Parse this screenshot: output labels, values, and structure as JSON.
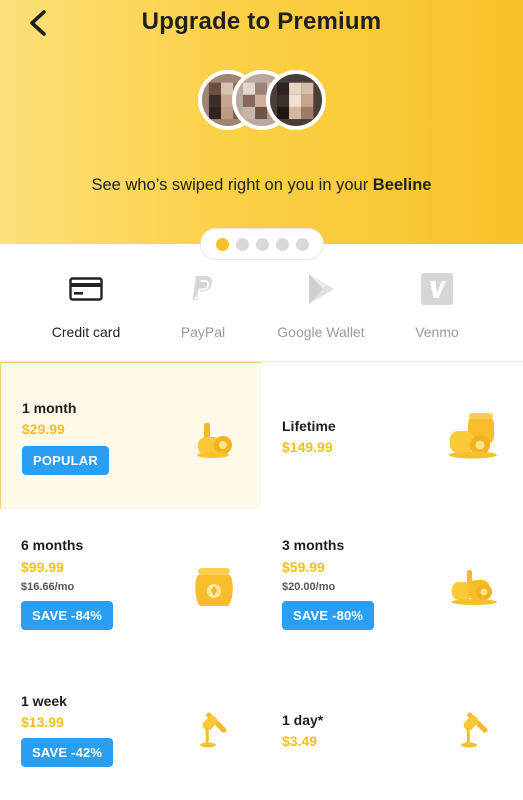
{
  "header": {
    "title": "Upgrade to Premium",
    "subtitle_prefix": "See who’s swiped right on you in your ",
    "subtitle_bold": "Beeline",
    "page_dots": 5,
    "active_dot": 0
  },
  "payment_methods": [
    {
      "label": "Credit card",
      "icon": "credit-card-icon",
      "active": true
    },
    {
      "label": "PayPal",
      "icon": "paypal-icon",
      "active": false
    },
    {
      "label": "Google Wallet",
      "icon": "google-wallet-icon",
      "active": false
    },
    {
      "label": "Venmo",
      "icon": "venmo-icon",
      "active": false
    }
  ],
  "plans": [
    {
      "name": "1 month",
      "price": "$29.99",
      "badge": "POPULAR",
      "selected": true,
      "icon": "honey-dipper-icon"
    },
    {
      "name": "Lifetime",
      "price": "$149.99",
      "selected": false,
      "icon": "honey-pots-icon"
    },
    {
      "name": "6 months",
      "price": "$99.99",
      "per_month": "$16.66/mo",
      "badge": "SAVE -84%",
      "selected": false,
      "icon": "honey-jar-icon"
    },
    {
      "name": "3 months",
      "price": "$59.99",
      "per_month": "$20.00/mo",
      "badge": "SAVE -80%",
      "selected": false,
      "icon": "honey-dipper-pile-icon"
    },
    {
      "name": "1 week",
      "price": "$13.99",
      "badge": "SAVE -42%",
      "selected": false,
      "icon": "honey-drip-icon"
    },
    {
      "name": "1 day*",
      "price": "$3.49",
      "selected": false,
      "icon": "honey-drip-icon"
    }
  ],
  "colors": {
    "header_start": "#fde07a",
    "header_end": "#f7c22a",
    "price": "#f4c01d",
    "badge": "#2a9ef2",
    "selected_bg": "#fff9e9"
  }
}
